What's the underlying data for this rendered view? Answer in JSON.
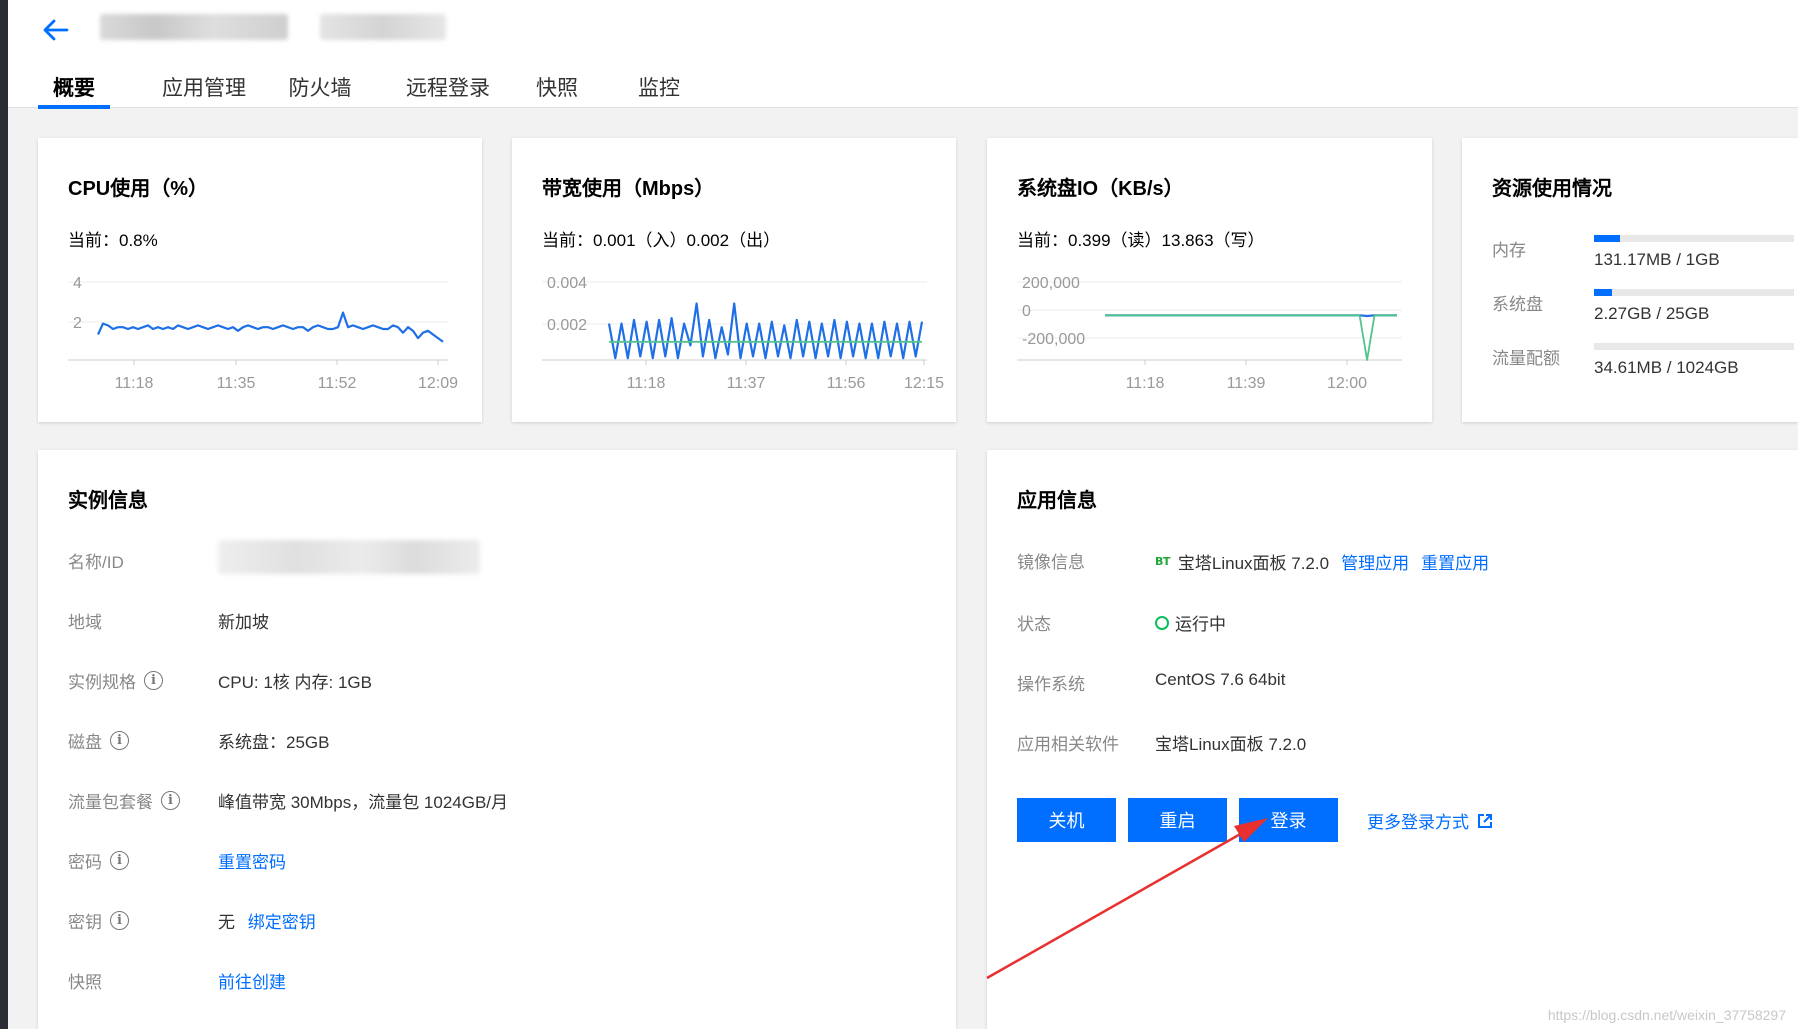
{
  "header": {
    "tabs": [
      {
        "label": "概要",
        "active": true
      },
      {
        "label": "应用管理",
        "active": false
      },
      {
        "label": "防火墙",
        "active": false
      },
      {
        "label": "远程登录",
        "active": false
      },
      {
        "label": "快照",
        "active": false
      },
      {
        "label": "监控",
        "active": false
      }
    ]
  },
  "colors": {
    "accent": "#006eff",
    "running": "#0abf5b",
    "secondary_series": "#52c48a"
  },
  "cpu_card": {
    "title": "CPU使用（%）",
    "current": "当前：0.8%"
  },
  "bandwidth_card": {
    "title": "带宽使用（Mbps）",
    "current": "当前：0.001（入）0.002（出）"
  },
  "disk_card": {
    "title": "系统盘IO（KB/s）",
    "current": "当前：0.399（读）13.863（写）"
  },
  "chart_data": [
    {
      "type": "line",
      "title": "CPU使用（%）",
      "x_ticks": [
        "11:18",
        "11:35",
        "11:52",
        "12:09"
      ],
      "y_ticks": [
        "4",
        "2"
      ],
      "ylim": [
        0,
        4.5
      ],
      "series": [
        {
          "values": [
            1.4,
            2.0,
            1.9,
            1.7,
            1.8,
            1.8,
            1.7,
            1.8,
            1.7,
            1.8,
            1.9,
            1.7,
            1.8,
            1.7,
            1.8,
            1.7,
            1.9,
            1.8,
            1.7,
            1.8,
            1.9,
            1.8,
            1.7,
            1.8,
            1.9,
            1.8,
            1.7,
            1.8,
            1.6,
            1.8,
            1.9,
            1.8,
            1.7,
            1.8,
            1.8,
            1.7,
            1.8,
            1.9,
            1.8,
            1.7,
            1.8,
            1.8,
            1.6,
            1.8,
            1.9,
            1.8,
            1.7,
            1.7,
            1.8,
            2.6,
            1.8,
            1.9,
            1.8,
            1.7,
            1.8,
            1.9,
            1.8,
            1.7,
            1.7,
            1.9,
            1.8,
            1.5,
            1.8,
            1.6,
            1.2,
            1.5,
            1.6,
            1.4,
            1.2,
            1.0
          ]
        }
      ]
    },
    {
      "type": "line",
      "title": "带宽使用（Mbps）",
      "x_ticks": [
        "11:18",
        "11:37",
        "11:56",
        "12:15"
      ],
      "y_ticks": [
        "0.004",
        "0.002"
      ],
      "ylim": [
        0,
        0.0045
      ],
      "series": [
        {
          "values": [
            0.002,
            0.0001,
            0.002,
            0.0001,
            0.0022,
            0.0002,
            0.0021,
            0.0001,
            0.0022,
            0.0002,
            0.0023,
            0.0001,
            0.002,
            0.0008,
            0.0031,
            0.0002,
            0.0022,
            0.0001,
            0.0018,
            0.0003,
            0.0031,
            0.0001,
            0.002,
            0.0002,
            0.002,
            0.0001,
            0.0021,
            0.0002,
            0.0019,
            0.0001,
            0.0022,
            0.0002,
            0.0021,
            0.0001,
            0.002,
            0.0002,
            0.0022,
            0.0001,
            0.0021,
            0.0002,
            0.002,
            0.0001,
            0.002,
            0.0001,
            0.0021,
            0.0002,
            0.002,
            0.0001,
            0.0021,
            0.0002,
            0.0021
          ]
        },
        {
          "values": [
            0.001,
            0.001,
            0.001,
            0.001,
            0.001,
            0.001,
            0.001,
            0.001,
            0.001,
            0.001,
            0.001,
            0.001,
            0.001,
            0.001,
            0.001,
            0.001,
            0.001,
            0.001,
            0.001,
            0.001,
            0.001,
            0.001,
            0.001,
            0.001,
            0.001,
            0.001,
            0.001,
            0.001,
            0.001,
            0.001,
            0.001,
            0.001,
            0.001,
            0.001,
            0.001,
            0.001,
            0.001,
            0.001,
            0.001,
            0.001,
            0.001,
            0.001,
            0.001,
            0.001,
            0.001,
            0.001,
            0.001,
            0.001,
            0.001,
            0.001,
            0.001
          ]
        }
      ]
    },
    {
      "type": "line",
      "title": "系统盘IO（KB/s）",
      "x_ticks": [
        "11:18",
        "11:39",
        "12:00"
      ],
      "y_ticks": [
        "200,000",
        "0",
        "-200,000"
      ],
      "ylim": [
        -300000,
        250000
      ],
      "series": [
        {
          "values": [
            0,
            0,
            0,
            0,
            0,
            0,
            0,
            0,
            0,
            0,
            0,
            0,
            0,
            0,
            0,
            0,
            0,
            0,
            0,
            0,
            0,
            0,
            0,
            0,
            0,
            0,
            0,
            0,
            0,
            0,
            0,
            0,
            0,
            0,
            0,
            -5000,
            0,
            0,
            0,
            0
          ]
        },
        {
          "values": [
            0,
            0,
            0,
            0,
            0,
            0,
            0,
            0,
            0,
            0,
            0,
            0,
            0,
            0,
            0,
            0,
            0,
            0,
            0,
            0,
            0,
            0,
            0,
            0,
            0,
            0,
            0,
            0,
            0,
            0,
            0,
            0,
            0,
            0,
            0,
            -300000,
            0,
            0,
            0,
            0
          ]
        }
      ]
    }
  ],
  "resources": {
    "title": "资源使用情况",
    "rows": [
      {
        "label": "内存",
        "value": "131.17MB / 1GB",
        "fraction": 0.128
      },
      {
        "label": "系统盘",
        "value": "2.27GB / 25GB",
        "fraction": 0.091
      },
      {
        "label": "流量配额",
        "value": "34.61MB / 1024GB",
        "fraction": 0.0
      }
    ]
  },
  "instance": {
    "title": "实例信息",
    "rows": [
      {
        "label": "名称/ID",
        "value": ""
      },
      {
        "label": "地域",
        "value": "新加坡"
      },
      {
        "label": "实例规格",
        "value": "CPU: 1核 内存: 1GB"
      },
      {
        "label": "磁盘",
        "value": "系统盘：25GB"
      },
      {
        "label": "流量包套餐",
        "value": "峰值带宽 30Mbps，流量包 1024GB/月"
      },
      {
        "label": "密码",
        "value": "重置密码"
      },
      {
        "label": "密钥",
        "value_prefix": "无",
        "value": "绑定密钥"
      },
      {
        "label": "快照",
        "value": "前往创建"
      }
    ]
  },
  "app": {
    "title": "应用信息",
    "rows": [
      {
        "label": "镜像信息",
        "logo": "BT",
        "value": "宝塔Linux面板 7.2.0",
        "link1": "管理应用",
        "link2": "重置应用"
      },
      {
        "label": "状态",
        "value": "运行中"
      },
      {
        "label": "操作系统",
        "value": "CentOS 7.6 64bit"
      },
      {
        "label": "应用相关软件",
        "value": "宝塔Linux面板 7.2.0"
      }
    ],
    "buttons": {
      "shutdown": "关机",
      "restart": "重启",
      "login": "登录"
    },
    "more_login": "更多登录方式"
  },
  "watermark": "https://blog.csdn.net/weixin_37758297"
}
